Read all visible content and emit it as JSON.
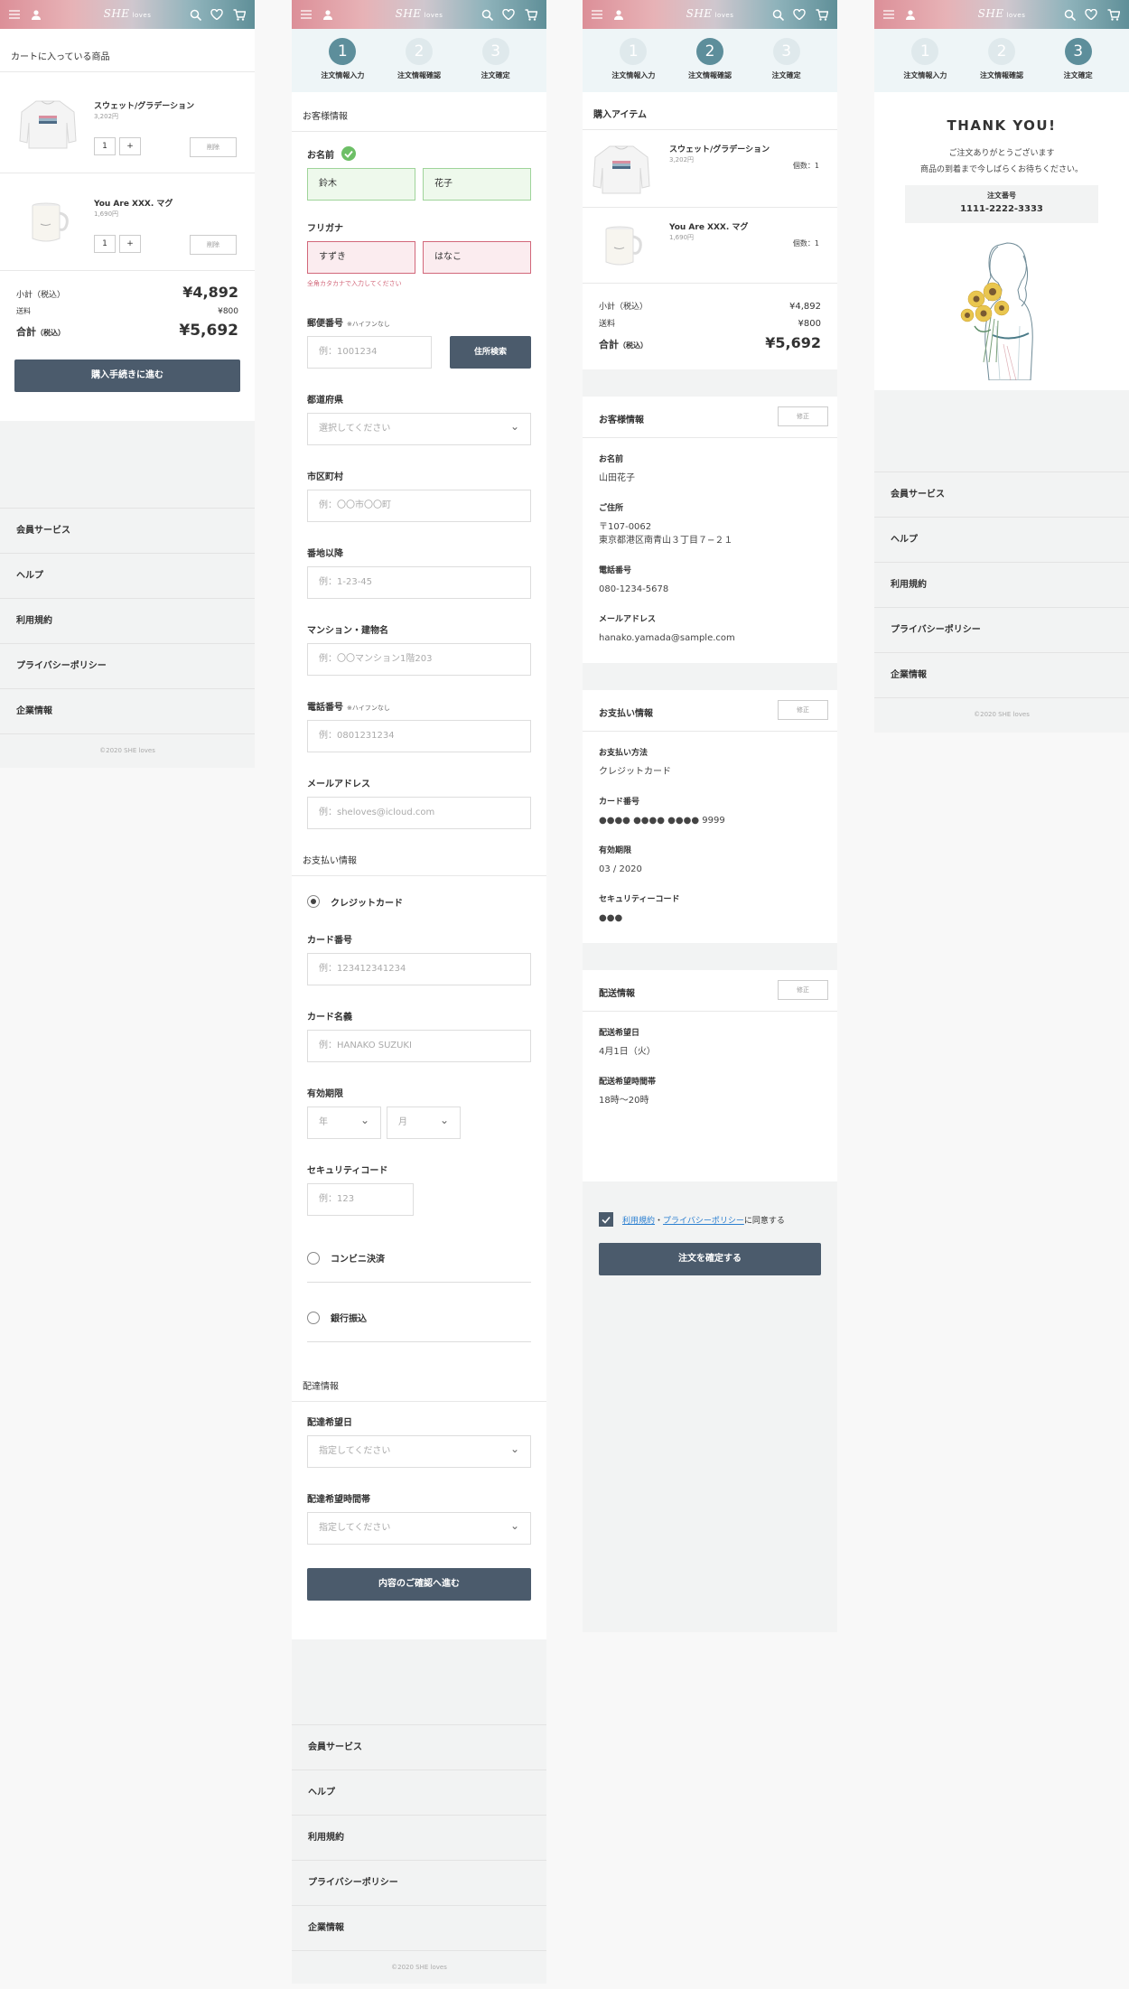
{
  "header": {
    "logo": "SHE",
    "logo_sub": "loves"
  },
  "steps": [
    {
      "num": "1",
      "label": "注文情報入力"
    },
    {
      "num": "2",
      "label": "注文情報確認"
    },
    {
      "num": "3",
      "label": "注文確定"
    }
  ],
  "cart": {
    "title": "カートに入っている商品",
    "items": [
      {
        "name": "スウェット/グラデーション",
        "price": "3,202円",
        "qty": "1",
        "minus": "1",
        "plus": "+",
        "delete": "削除"
      },
      {
        "name": "You Are XXX. マグ",
        "price": "1,690円",
        "qty": "1",
        "plus": "+",
        "delete": "削除"
      }
    ],
    "subtotal_label": "小計（税込）",
    "subtotal": "¥4,892",
    "shipping_label": "送料",
    "shipping": "¥800",
    "total_label": "合計",
    "total_tax": "（税込）",
    "total": "¥5,692",
    "checkout": "購入手続きに進む"
  },
  "footer": {
    "links": [
      "会員サービス",
      "ヘルプ",
      "利用規約",
      "プライバシーポリシー",
      "企業情報"
    ],
    "copyright": "©2020 SHE loves"
  },
  "form": {
    "customer_title": "お客様情報",
    "name_label": "お名前",
    "last_name": "鈴木",
    "first_name": "花子",
    "kana_label": "フリガナ",
    "last_kana": "すずき",
    "first_kana": "はなこ",
    "kana_error": "全角カタカナで入力してください",
    "zip_label": "郵便番号",
    "zip_note": "※ハイフンなし",
    "zip_ph": "例：1001234",
    "zip_btn": "住所検索",
    "pref_label": "都道府県",
    "pref_ph": "選択してください",
    "city_label": "市区町村",
    "city_ph": "例：〇〇市〇〇町",
    "addr_label": "番地以降",
    "addr_ph": "例：1-23-45",
    "bldg_label": "マンション・建物名",
    "bldg_ph": "例：〇〇マンション1階203",
    "tel_label": "電話番号",
    "tel_note": "※ハイフンなし",
    "tel_ph": "例：0801231234",
    "mail_label": "メールアドレス",
    "mail_ph": "例：sheloves@icloud.com",
    "pay_title": "お支払い情報",
    "pay_credit": "クレジットカード",
    "card_no_label": "カード番号",
    "card_no_ph": "例：123412341234",
    "card_name_label": "カード名義",
    "card_name_ph": "例：HANAKO SUZUKI",
    "exp_label": "有効期限",
    "exp_year": "年",
    "exp_month": "月",
    "cvc_label": "セキュリティコード",
    "cvc_ph": "例：123",
    "pay_konbini": "コンビニ決済",
    "pay_bank": "銀行振込",
    "ship_title": "配達情報",
    "ship_date_label": "配達希望日",
    "ship_date_ph": "指定してください",
    "ship_time_label": "配達希望時間帯",
    "ship_time_ph": "指定してください",
    "submit": "内容のご確認へ進む"
  },
  "confirm": {
    "items_title": "購入アイテム",
    "items": [
      {
        "name": "スウェット/グラデーション",
        "price": "3,202円",
        "count": "個数：1"
      },
      {
        "name": "You Are XXX. マグ",
        "price": "1,690円",
        "count": "個数：1"
      }
    ],
    "subtotal_label": "小計（税込）",
    "subtotal": "¥4,892",
    "shipping_label": "送料",
    "shipping": "¥800",
    "total_label": "合計",
    "total_tax": "（税込）",
    "total": "¥5,692",
    "edit": "修正",
    "customer_title": "お客様情報",
    "name_label": "お名前",
    "name": "山田花子",
    "address_label": "ご住所",
    "zip": "〒107-0062",
    "address": "東京都港区南青山３丁目７−２１",
    "tel_label": "電話番号",
    "tel": "080-1234-5678",
    "mail_label": "メールアドレス",
    "mail": "hanako.yamada@sample.com",
    "pay_title": "お支払い情報",
    "method_label": "お支払い方法",
    "method": "クレジットカード",
    "card_label": "カード番号",
    "card_mask": "●●●● ●●●● ●●●●",
    "card_last": "9999",
    "exp_label": "有効期限",
    "exp": "03 / 2020",
    "cvc_label": "セキュリティーコード",
    "cvc": "●●●",
    "ship_title": "配送情報",
    "date_label": "配送希望日",
    "date": "4月1日（火）",
    "time_label": "配送希望時間帯",
    "time": "18時〜20時",
    "terms": "利用規約",
    "dot": "・",
    "privacy": "プライバシーポリシー",
    "agree": "に同意する",
    "submit": "注文を確定する"
  },
  "thanks": {
    "title": "THANK YOU!",
    "line1": "ご注文ありがとうございます",
    "line2": "商品の到着まで今しばらくお待ちください。",
    "order_label": "注文番号",
    "order_no": "1111-2222-3333"
  },
  "colors": {
    "accent": "#5d8e9b",
    "button": "#4b5b6c",
    "error": "#d2677a",
    "ok": "#6dbf66"
  }
}
